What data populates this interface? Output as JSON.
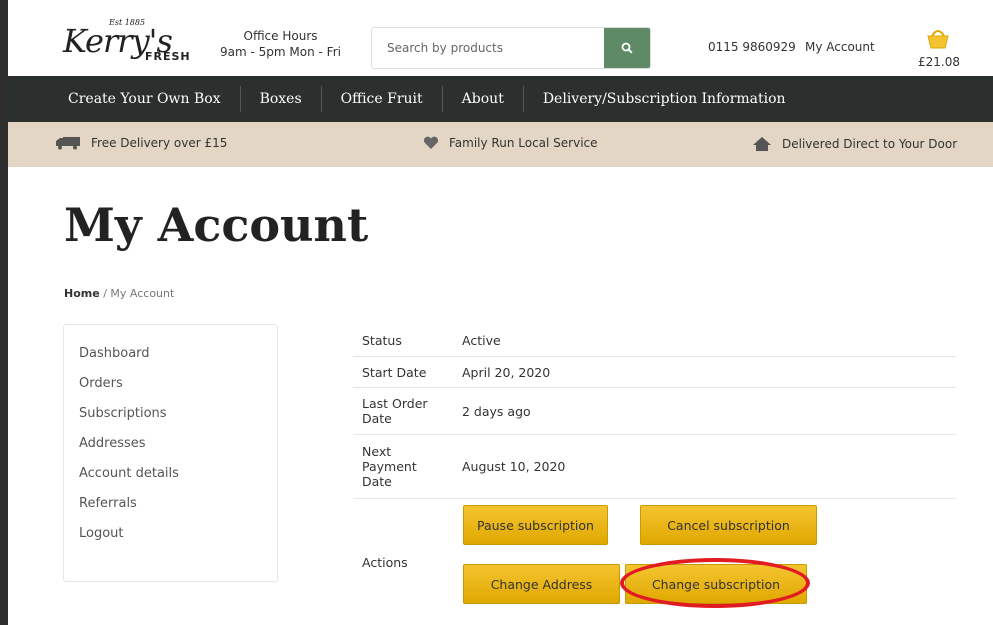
{
  "brand": {
    "est": "Est 1885",
    "name": "Kerry's",
    "fresh": "FRESH"
  },
  "header": {
    "office_hours_title": "Office Hours",
    "office_hours_time": "9am - 5pm Mon - Fri",
    "search_placeholder": "Search by products",
    "phone": "0115 9860929",
    "account_link": "My Account",
    "basket_total": "£21.08"
  },
  "nav": [
    "Create Your Own Box",
    "Boxes",
    "Office Fruit",
    "About",
    "Delivery/Subscription Information"
  ],
  "usp": [
    "Free Delivery over £15",
    "Family Run Local Service",
    "Delivered Direct to Your Door"
  ],
  "page": {
    "title": "My Account",
    "breadcrumb_home": "Home",
    "breadcrumb_current": "My Account"
  },
  "sidebar": [
    "Dashboard",
    "Orders",
    "Subscriptions",
    "Addresses",
    "Account details",
    "Referrals",
    "Logout"
  ],
  "subscription": {
    "rows": [
      {
        "label": "Status",
        "value": "Active"
      },
      {
        "label": "Start Date",
        "value": "April 20, 2020"
      },
      {
        "label": "Last Order Date",
        "value": "2 days ago"
      },
      {
        "label": "Next Payment Date",
        "value": "August 10, 2020"
      }
    ],
    "actions_label": "Actions",
    "buttons": {
      "pause": "Pause subscription",
      "cancel": "Cancel subscription",
      "change_address": "Change Address",
      "change_subscription": "Change subscription"
    }
  },
  "colors": {
    "accent_green": "#5f8a66",
    "nav_bg": "#2b2f2d",
    "usp_bg": "#e3d6c4",
    "button_yellow": "#f4c430",
    "annotation_red": "#e21b23"
  }
}
